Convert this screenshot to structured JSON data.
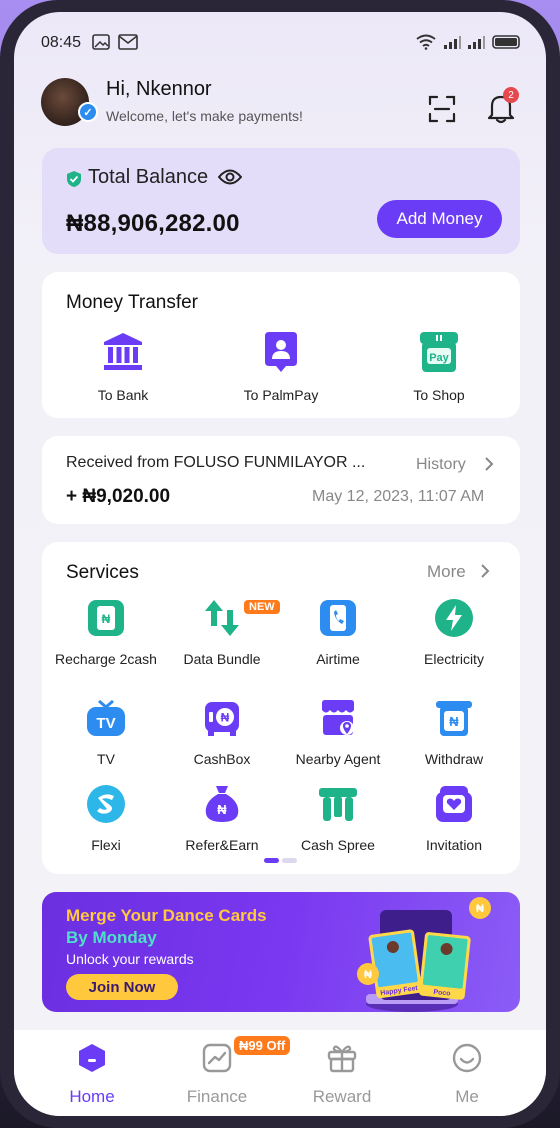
{
  "status_bar": {
    "time": "08:45"
  },
  "header": {
    "greeting": "Hi, Nkennor",
    "welcome": "Welcome, let's make payments!",
    "notification_count": "2"
  },
  "balance": {
    "label": "Total Balance",
    "amount": "₦88,906,282.00",
    "add_money_label": "Add Money"
  },
  "money_transfer": {
    "title": "Money Transfer",
    "items": [
      {
        "label": "To Bank",
        "icon": "bank-icon"
      },
      {
        "label": "To PalmPay",
        "icon": "palmpay-user-icon"
      },
      {
        "label": "To Shop",
        "icon": "shop-pay-icon"
      }
    ]
  },
  "recent": {
    "from": "Received from FOLUSO FUNMILAYOR  ...",
    "amount": "+ ₦9,020.00",
    "history_label": "History",
    "date": "May 12, 2023, 11:07 AM"
  },
  "services": {
    "title": "Services",
    "more_label": "More",
    "new_badge": "NEW",
    "items": [
      {
        "label": "Recharge 2cash",
        "icon": "recharge-icon"
      },
      {
        "label": "Data Bundle",
        "icon": "data-bundle-icon"
      },
      {
        "label": "Airtime",
        "icon": "phone-icon"
      },
      {
        "label": "Electricity",
        "icon": "lightning-icon"
      },
      {
        "label": "TV",
        "icon": "tv-icon"
      },
      {
        "label": "CashBox",
        "icon": "cashbox-icon"
      },
      {
        "label": "Nearby Agent",
        "icon": "store-location-icon"
      },
      {
        "label": "Withdraw",
        "icon": "withdraw-icon"
      },
      {
        "label": "Flexi",
        "icon": "flexi-icon"
      },
      {
        "label": "Refer&Earn",
        "icon": "money-bag-icon"
      },
      {
        "label": "Cash Spree",
        "icon": "cash-spree-icon"
      },
      {
        "label": "Invitation",
        "icon": "invitation-icon"
      }
    ]
  },
  "banner": {
    "line1": "Merge Your Dance Cards",
    "line2": "By Monday",
    "line3": "Unlock your rewards",
    "button": "Join Now",
    "card1": "Happy Feet",
    "card2": "Poco"
  },
  "tabbar": {
    "items": [
      {
        "label": "Home",
        "active": true
      },
      {
        "label": "Finance",
        "active": false
      },
      {
        "label": "Reward",
        "active": false
      },
      {
        "label": "Me",
        "active": false
      }
    ],
    "finance_badge": "₦99 Off"
  },
  "colors": {
    "accent": "#6b3cf6",
    "green": "#1fb38a",
    "blue": "#2d8cf0",
    "orange": "#ff7a1a"
  }
}
